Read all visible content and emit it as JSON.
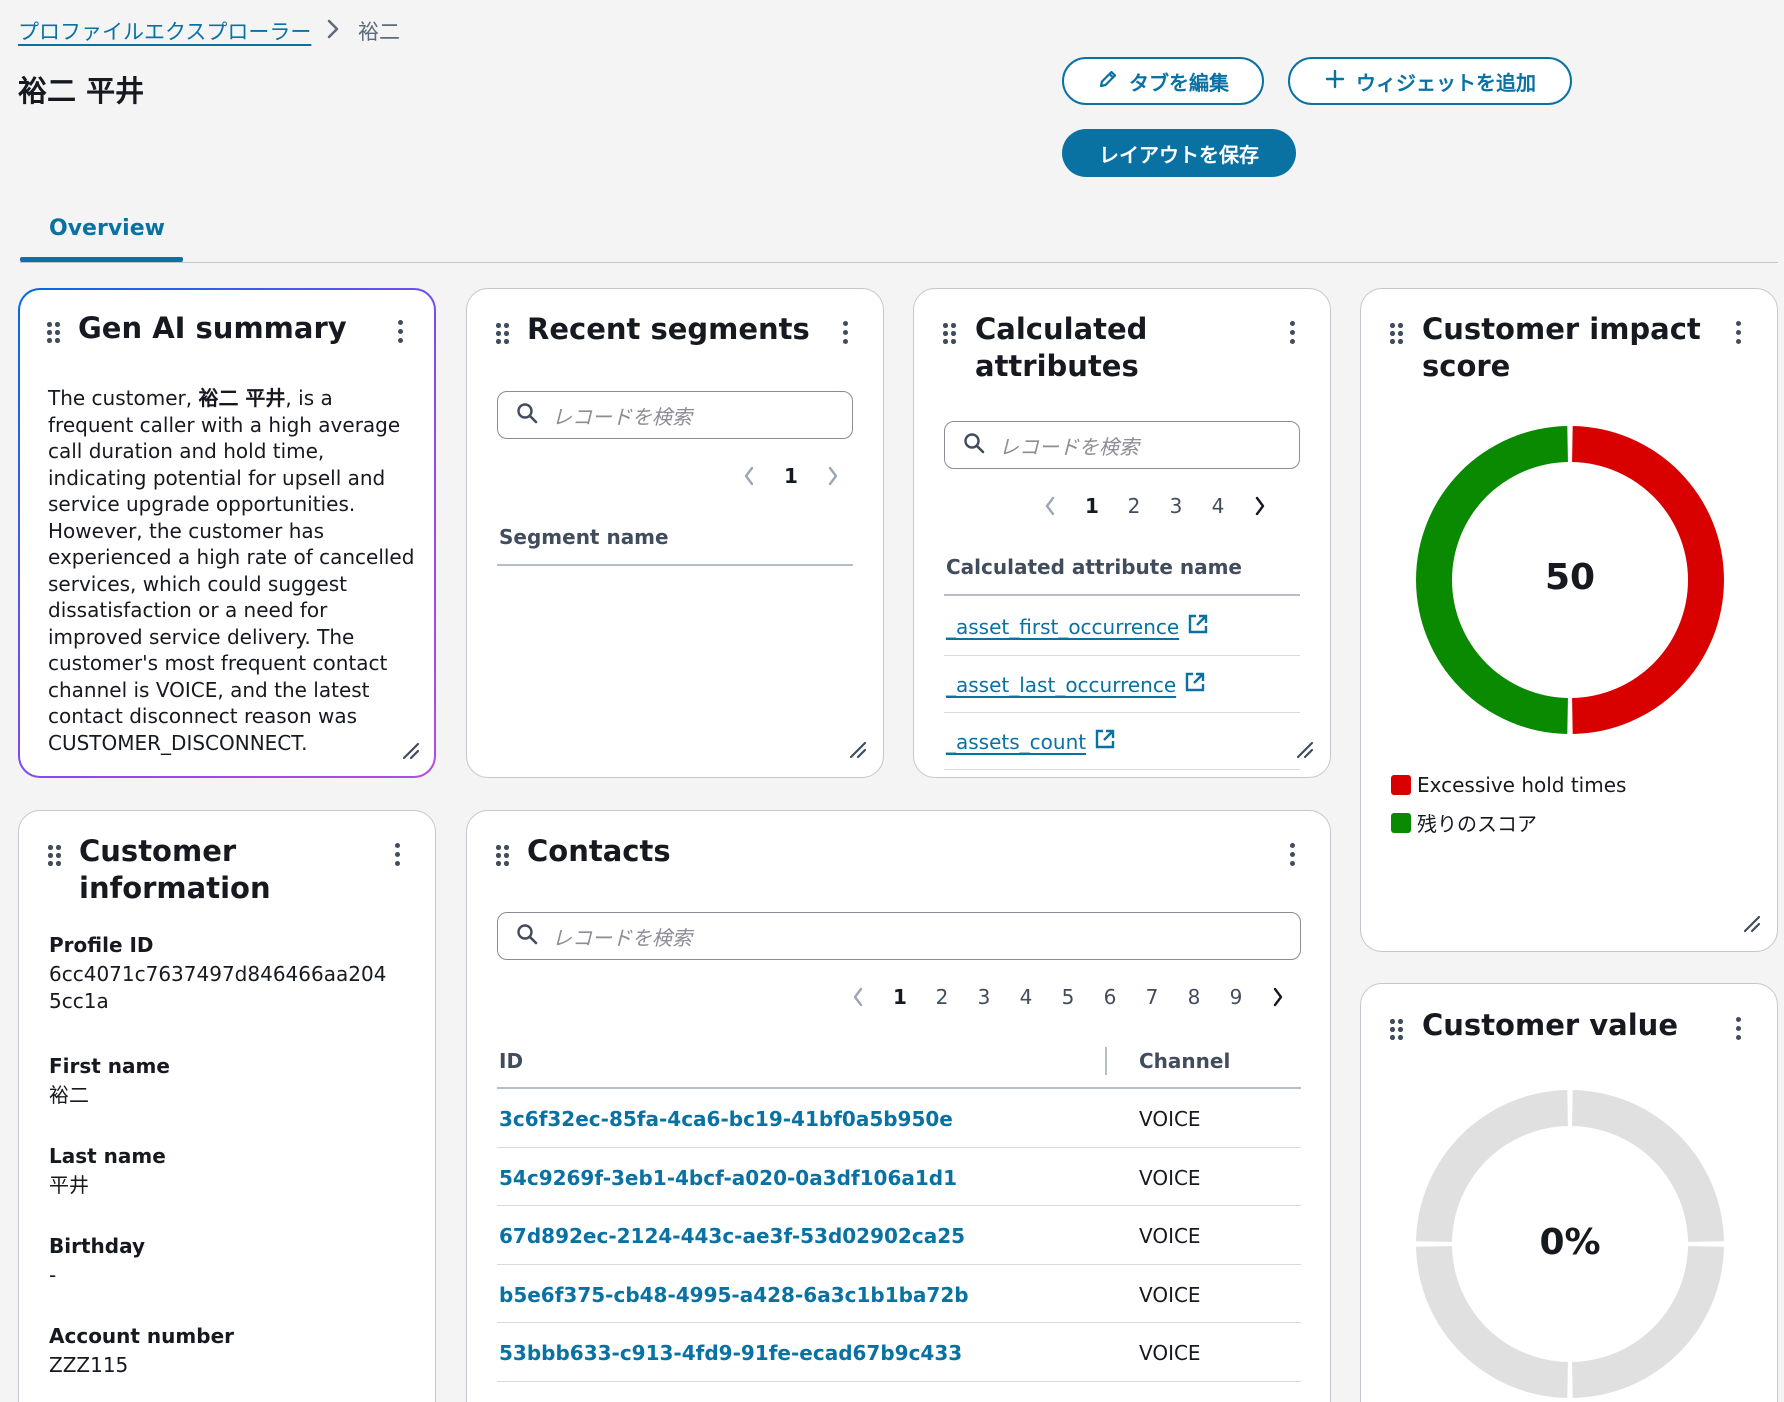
{
  "breadcrumb": {
    "parent": "プロファイルエクスプローラー",
    "current": "裕二"
  },
  "page_title": "裕二 平井",
  "header_buttons": {
    "edit_tabs": "タブを編集",
    "add_widget": "ウィジェットを追加",
    "save_layout": "レイアウトを保存"
  },
  "tabs": [
    {
      "label": "Overview"
    }
  ],
  "search_placeholder": "レコードを検索",
  "gen_ai": {
    "title": "Gen AI summary",
    "text_before": "The customer, ",
    "text_name": "裕二 平井",
    "text_after": ", is a frequent caller with a high average call duration and hold time, indicating potential for upsell and service upgrade opportunities. However, the customer has experienced a high rate of cancelled services, which could suggest dissatisfaction or a need for improved service delivery. The customer's most frequent contact channel is VOICE, and the latest contact disconnect reason was CUSTOMER_DISCONNECT."
  },
  "recent_segments": {
    "title": "Recent segments",
    "pages": [
      "1"
    ],
    "column": "Segment name"
  },
  "calculated_attributes": {
    "title_line1": "Calculated",
    "title_line2": "attributes",
    "pages": [
      "1",
      "2",
      "3",
      "4"
    ],
    "column": "Calculated attribute name",
    "rows": [
      "_asset_first_occurrence",
      "_asset_last_occurrence",
      "_assets_count"
    ]
  },
  "impact_score": {
    "title_line1": "Customer impact",
    "title_line2": "score",
    "center_value": "50",
    "legend": [
      {
        "label": "Excessive hold times",
        "color": "#d90000",
        "value": 50
      },
      {
        "label": "残りのスコア",
        "color": "#0a8a00",
        "value": 50
      }
    ]
  },
  "customer_info": {
    "title_line1": "Customer",
    "title_line2": "information",
    "fields": [
      {
        "label": "Profile ID",
        "value_line1": "6cc4071c7637497d846466aa204",
        "value_line2": "5cc1a"
      },
      {
        "label": "First name",
        "value": "裕二"
      },
      {
        "label": "Last name",
        "value": "平井"
      },
      {
        "label": "Birthday",
        "value": "-"
      },
      {
        "label": "Account number",
        "value": "ZZZ115"
      }
    ]
  },
  "contacts": {
    "title": "Contacts",
    "pages": [
      "1",
      "2",
      "3",
      "4",
      "5",
      "6",
      "7",
      "8",
      "9"
    ],
    "columns": {
      "id": "ID",
      "channel": "Channel"
    },
    "rows": [
      {
        "id": "3c6f32ec-85fa-4ca6-bc19-41bf0a5b950e",
        "channel": "VOICE"
      },
      {
        "id": "54c9269f-3eb1-4bcf-a020-0a3df106a1d1",
        "channel": "VOICE"
      },
      {
        "id": "67d892ec-2124-443c-ae3f-53d02902ca25",
        "channel": "VOICE"
      },
      {
        "id": "b5e6f375-cb48-4995-a428-6a3c1b1ba72b",
        "channel": "VOICE"
      },
      {
        "id": "53bbb633-c913-4fd9-91fe-ecad67b9c433",
        "channel": "VOICE"
      }
    ]
  },
  "customer_value": {
    "title": "Customer value",
    "center_value": "0%",
    "ring_color": "#e0e0e0"
  },
  "colors": {
    "accent": "#0972a3",
    "page_bg": "#f4f4f4"
  }
}
